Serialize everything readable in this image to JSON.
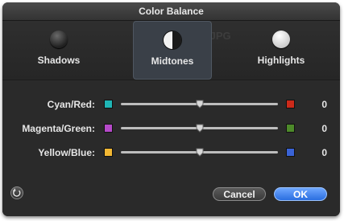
{
  "window": {
    "title": "Color Balance"
  },
  "background_ghost_text": "mousel13.JPG",
  "tones": [
    {
      "label": "Shadows",
      "selected": false,
      "icon": "shadows-circle-icon"
    },
    {
      "label": "Midtones",
      "selected": true,
      "icon": "midtones-circle-icon"
    },
    {
      "label": "Highlights",
      "selected": false,
      "icon": "highlights-circle-icon"
    }
  ],
  "sliders": [
    {
      "label": "Cyan/Red:",
      "value": "0",
      "left_color": "#1fb5b5",
      "right_color": "#cc2a1a"
    },
    {
      "label": "Magenta/Green:",
      "value": "0",
      "left_color": "#b64ac9",
      "right_color": "#4d8a2a"
    },
    {
      "label": "Yellow/Blue:",
      "value": "0",
      "left_color": "#f2b733",
      "right_color": "#3a63d6"
    }
  ],
  "buttons": {
    "reset_icon": "reset-icon",
    "cancel": "Cancel",
    "ok": "OK"
  },
  "colors": {
    "accent": "#2a6ee0",
    "panel": "#2b2b2b"
  }
}
